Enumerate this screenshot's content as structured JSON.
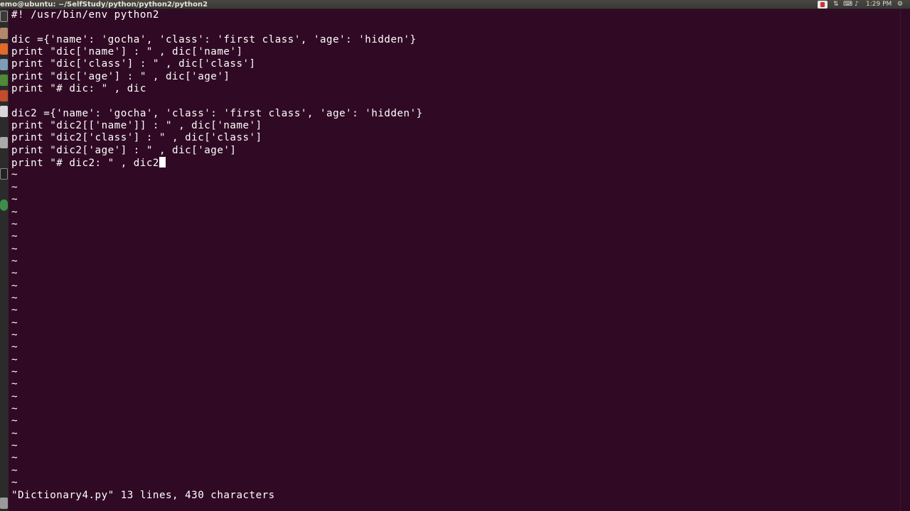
{
  "panel": {
    "window_title": "emo@ubuntu: ~/SelfStudy/python/python2/python2",
    "clock": "1:29 PM",
    "tray_icons": [
      "indicator-icon",
      "transfer-icon",
      "keyboard-icon",
      "sound-icon",
      "gear-icon"
    ]
  },
  "launcher": {
    "icons": [
      "terminal-icon",
      "home-folder-icon",
      "firefox-icon",
      "files-icon",
      "libreoffice-writer-icon",
      "libreoffice-impress-icon",
      "amazon-icon",
      "system-tools-icon",
      "terminal-icon",
      "software-updater-icon",
      "trash-icon"
    ]
  },
  "editor": {
    "lines": [
      "#! /usr/bin/env python2",
      "",
      "dic ={'name': 'gocha', 'class': 'first class', 'age': 'hidden'}",
      "print \"dic['name'] : \" , dic['name']",
      "print \"dic['class'] : \" , dic['class']",
      "print \"dic['age'] : \" , dic['age']",
      "print \"# dic: \" , dic",
      "",
      "dic2 ={'name': 'gocha', 'class': 'first class', 'age': 'hidden'}",
      "print \"dic2[['name']] : \" , dic['name']",
      "print \"dic2['class'] : \" , dic['class']",
      "print \"dic2['age'] : \" , dic['age']",
      "print \"# dic2: \" , dic2"
    ],
    "tilde": "~",
    "status_line": "\"Dictionary4.py\" 13 lines, 430 characters"
  },
  "colors": {
    "terminal_background": "#300a24",
    "text": "#ffffff"
  }
}
